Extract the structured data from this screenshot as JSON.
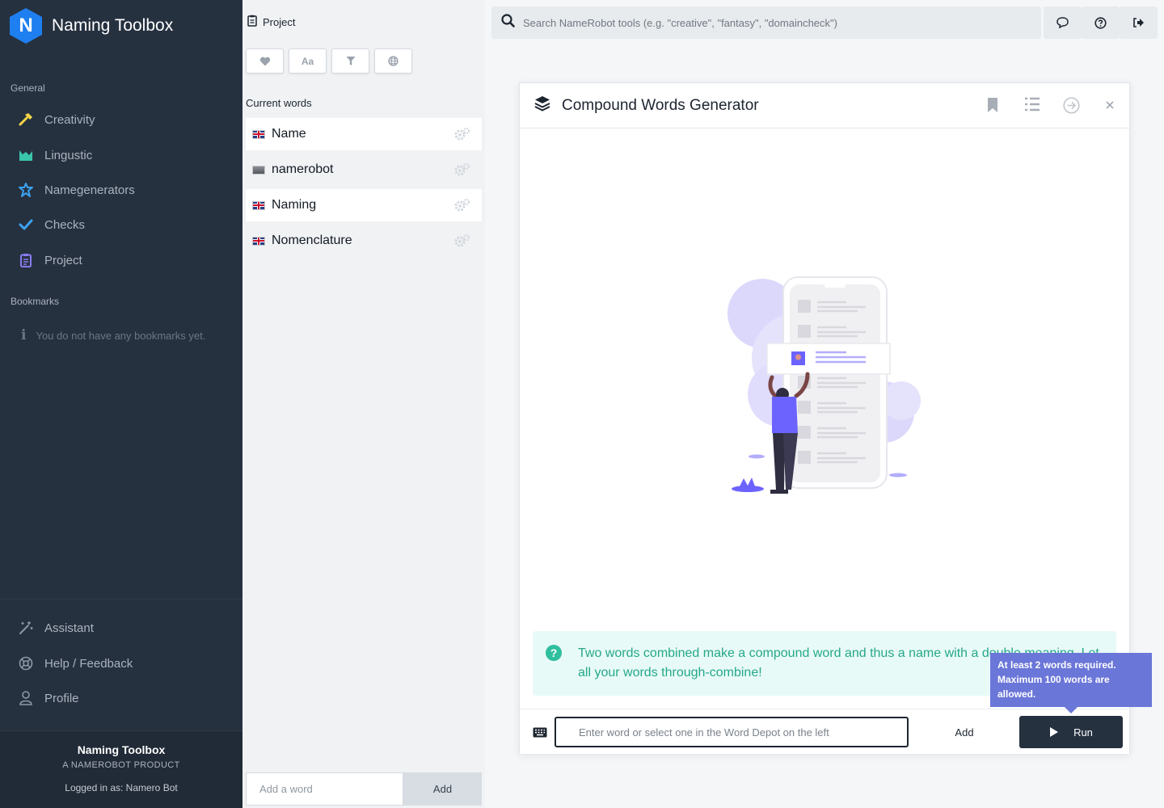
{
  "app": {
    "logo_letter": "N",
    "title": "Naming Toolbox"
  },
  "sidebar": {
    "general_title": "General",
    "nav": [
      {
        "label": "Creativity",
        "icon": "hammer-icon",
        "color": "#f5d547"
      },
      {
        "label": "Lingustic",
        "icon": "chart-icon",
        "color": "#39c5a9"
      },
      {
        "label": "Namegenerators",
        "icon": "star-badge-icon",
        "color": "#3ca3f0"
      },
      {
        "label": "Checks",
        "icon": "check-icon",
        "color": "#3ca3f0"
      },
      {
        "label": "Project",
        "icon": "clipboard-icon",
        "color": "#8a7cf0"
      }
    ],
    "bookmarks_title": "Bookmarks",
    "bookmarks_empty": "You do not have any bookmarks yet.",
    "bottom_nav": [
      {
        "label": "Assistant",
        "icon": "magic-wand-icon"
      },
      {
        "label": "Help / Feedback",
        "icon": "lifebuoy-icon"
      },
      {
        "label": "Profile",
        "icon": "user-icon"
      }
    ],
    "footer": {
      "title": "Naming Toolbox",
      "subtitle": "A NAMEROBOT PRODUCT",
      "logged_in": "Logged in as: Namero Bot"
    }
  },
  "depot": {
    "header": "Project",
    "tools": [
      {
        "icon": "heart-icon"
      },
      {
        "label": "Aa",
        "icon": "font-icon"
      },
      {
        "icon": "filter-icon"
      },
      {
        "icon": "globe-icon"
      }
    ],
    "current_title": "Current words",
    "words": [
      {
        "label": "Name",
        "flag": "uk"
      },
      {
        "label": "namerobot",
        "flag": "none"
      },
      {
        "label": "Naming",
        "flag": "uk"
      },
      {
        "label": "Nomenclature",
        "flag": "uk"
      }
    ],
    "add_placeholder": "Add a word",
    "add_label": "Add"
  },
  "search": {
    "placeholder": "Search NameRobot tools (e.g. \"creative\", \"fantasy\", \"domaincheck\")"
  },
  "topbar": {
    "buttons": [
      "chat-icon",
      "help-icon",
      "logout-icon"
    ]
  },
  "tool": {
    "title": "Compound Words Generator",
    "info": "Two words combined make a compound word and thus a name with a double meaning. Let all your words through-combine!",
    "input_placeholder": "Enter word or select one in the Word Depot on the left",
    "add_label": "Add",
    "run_label": "Run",
    "tooltip": "At least 2 words required. Maximum 100 words are allowed."
  },
  "colors": {
    "sidebar": "#263140",
    "accent": "#1e7ff0",
    "info": "#25a88a",
    "tooltip": "#6a76d8"
  }
}
